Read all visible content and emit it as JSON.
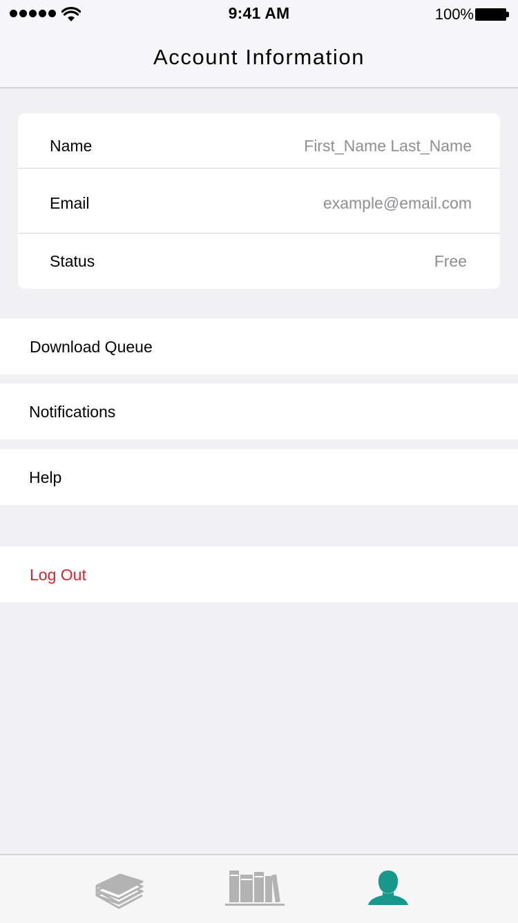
{
  "status_bar": {
    "time": "9:41 AM",
    "battery": "100%"
  },
  "nav": {
    "title": "Account Information"
  },
  "account": {
    "name_label": "Name",
    "name_value": "First_Name Last_Name",
    "email_label": "Email",
    "email_value": "example@email.com",
    "status_label": "Status",
    "status_value": "Free"
  },
  "menu": {
    "download_queue": "Download Queue",
    "notifications": "Notifications",
    "help": "Help",
    "logout": "Log Out"
  },
  "tabs": [
    {
      "icon": "books-stack-icon",
      "active": false
    },
    {
      "icon": "bookshelf-icon",
      "active": false
    },
    {
      "icon": "profile-icon",
      "active": true
    }
  ],
  "colors": {
    "accent": "#17988a",
    "destructive": "#e3212d",
    "secondary_text": "#8e8e93",
    "background": "#f1f1f3",
    "inactive_icon": "#b3b3b3"
  }
}
